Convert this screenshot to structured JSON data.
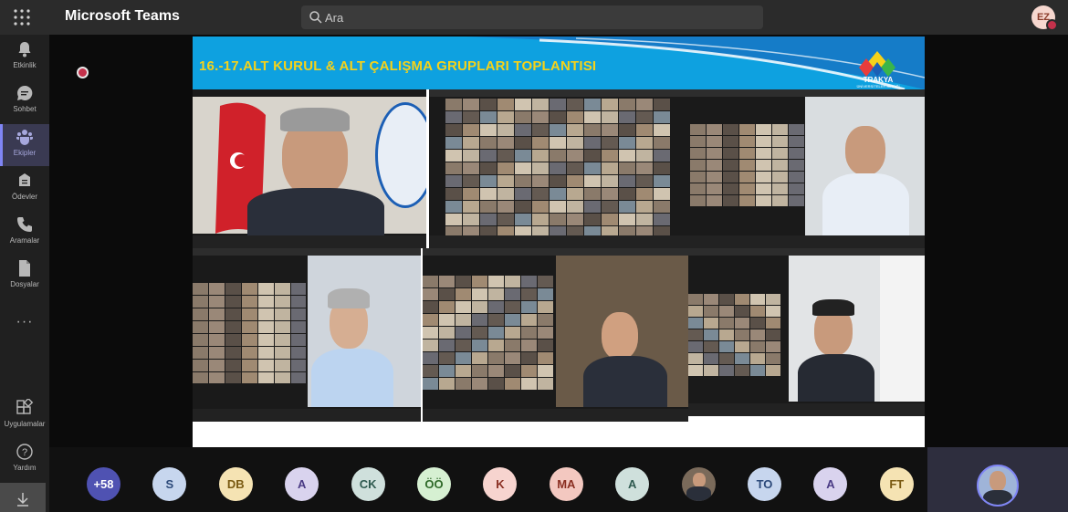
{
  "app": {
    "title": "Microsoft Teams"
  },
  "search": {
    "placeholder": "Ara"
  },
  "user": {
    "initials": "EZ"
  },
  "sidebar": {
    "items": [
      {
        "label": "Etkinlik",
        "icon": "bell-icon"
      },
      {
        "label": "Sohbet",
        "icon": "chat-icon"
      },
      {
        "label": "Ekipler",
        "icon": "teams-icon",
        "active": true
      },
      {
        "label": "Ödevler",
        "icon": "assignments-icon"
      },
      {
        "label": "Aramalar",
        "icon": "phone-icon"
      },
      {
        "label": "Dosyalar",
        "icon": "files-icon"
      }
    ],
    "more": "···",
    "apps_label": "Uygulamalar",
    "help_label": "Yardım"
  },
  "slide": {
    "title": "16.-17.ALT KURUL & ALT ÇALIŞMA GRUPLARI TOPLANTISI",
    "logo_text": "TRAKYA",
    "logo_sub": "ÜNİVERSİTELER BİRLİĞİ"
  },
  "participants": [
    {
      "label": "+58",
      "bg": "#4f52b2",
      "fg": "#ffffff"
    },
    {
      "label": "S",
      "bg": "#c7d6ee",
      "fg": "#2d4a7a"
    },
    {
      "label": "DB",
      "bg": "#f5e3b3",
      "fg": "#7a5a12"
    },
    {
      "label": "A",
      "bg": "#d9d3ee",
      "fg": "#4a3b85"
    },
    {
      "label": "CK",
      "bg": "#cfe0dc",
      "fg": "#2f5a50"
    },
    {
      "label": "ÖÖ",
      "bg": "#d6f0d2",
      "fg": "#2f6a2a"
    },
    {
      "label": "K",
      "bg": "#f7d4cf",
      "fg": "#8a2f22"
    },
    {
      "label": "MA",
      "bg": "#f3c8c0",
      "fg": "#8a2f22"
    },
    {
      "label": "A",
      "bg": "#cfe0dc",
      "fg": "#2f5a50"
    },
    {
      "label": "",
      "bg": "#7a6a5a",
      "fg": "#ffffff",
      "photo": true
    },
    {
      "label": "TO",
      "bg": "#c7d6ee",
      "fg": "#2d4a7a"
    },
    {
      "label": "A",
      "bg": "#d9d3ee",
      "fg": "#4a3b85"
    },
    {
      "label": "FT",
      "bg": "#f5e3b3",
      "fg": "#7a5a12"
    }
  ]
}
